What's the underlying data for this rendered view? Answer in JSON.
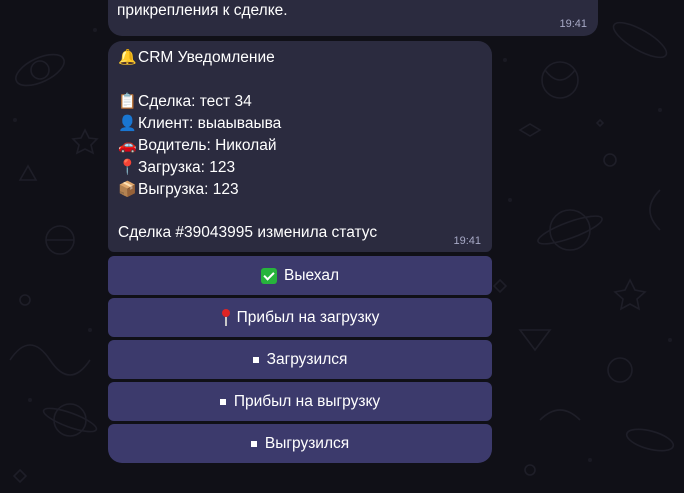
{
  "top_message": {
    "partial_line": "прикрепления к сделке.",
    "time": "19:41"
  },
  "notification": {
    "title_icon": "bell-icon",
    "title": "CRM Уведомление",
    "deal_icon": "clipboard-icon",
    "deal": "Сделка: тест 34",
    "client_icon": "user-icon",
    "client": "Клиент: выаываыва",
    "driver_icon": "car-icon",
    "driver": "Водитель: Николай",
    "loading_icon": "pin-icon",
    "loading": "Загрузка: 123",
    "unloading_icon": "package-icon",
    "unloading": "Выгрузка: 123",
    "status": "Сделка #39043995 изменила статус",
    "time": "19:41"
  },
  "buttons": [
    {
      "icon": "check-icon",
      "label": "Выехал"
    },
    {
      "icon": "pin-icon",
      "label": "Прибыл на загрузку"
    },
    {
      "icon": "square-icon",
      "label": "Загрузился"
    },
    {
      "icon": "square-icon",
      "label": "Прибыл на выгрузку"
    },
    {
      "icon": "square-icon",
      "label": "Выгрузился"
    }
  ],
  "colors": {
    "background": "#101017",
    "bubble": "#2b2b3f",
    "button": "#3c3a6c",
    "timestamp": "#a7a9c6"
  }
}
